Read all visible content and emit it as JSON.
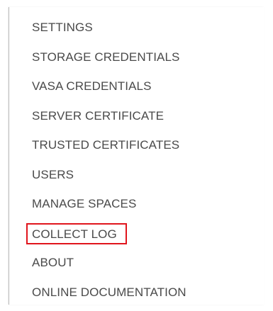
{
  "menu": {
    "items": [
      {
        "label": "SETTINGS"
      },
      {
        "label": "STORAGE CREDENTIALS"
      },
      {
        "label": "VASA CREDENTIALS"
      },
      {
        "label": "SERVER CERTIFICATE"
      },
      {
        "label": "TRUSTED CERTIFICATES"
      },
      {
        "label": "USERS"
      },
      {
        "label": "MANAGE SPACES"
      },
      {
        "label": "COLLECT LOG",
        "highlighted": true
      },
      {
        "label": "ABOUT"
      },
      {
        "label": "ONLINE DOCUMENTATION"
      }
    ]
  },
  "colors": {
    "text": "#4a4a4a",
    "highlight_border": "#e0151d",
    "panel_border": "#b8b8b8"
  }
}
